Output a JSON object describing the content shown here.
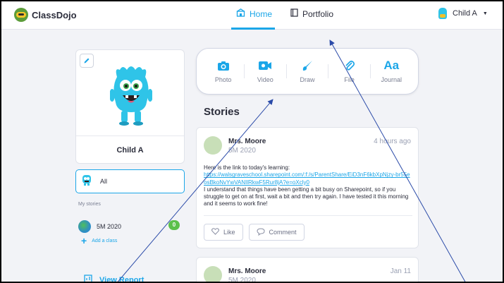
{
  "header": {
    "brand": "ClassDojo",
    "nav_home": "Home",
    "nav_portfolio": "Portfolio",
    "child_menu": "Child A",
    "accent": "#1ba6e8"
  },
  "profile": {
    "name": "Child A"
  },
  "sidebar": {
    "all_label": "All",
    "my_stories_label": "My stories",
    "class_name": "5M 2020",
    "class_badge": "0",
    "add_class_label": "Add a class",
    "view_report_label": "View Report"
  },
  "composer": {
    "items": [
      {
        "label": "Photo",
        "icon": "camera-icon"
      },
      {
        "label": "Video",
        "icon": "video-camera-icon"
      },
      {
        "label": "Draw",
        "icon": "brush-icon"
      },
      {
        "label": "File",
        "icon": "paperclip-icon"
      },
      {
        "label": "Journal",
        "icon": "text-aa-icon",
        "glyph": "Aa"
      }
    ]
  },
  "stories": {
    "title": "Stories",
    "posts": [
      {
        "author": "Mrs. Moore",
        "class": "5M 2020",
        "time": "4 hours ago",
        "intro": "Here is the link to today's learning:",
        "link": "https://walsgraveschool.sharepoint.com/:f:/s/ParentShare/EiD3nF6kbXpNjzy-br55eosBkoNvYwVANIlRkwF5Rur8jA?e=oXcly0",
        "body": "I understand that things have been getting a bit busy on Sharepoint, so if you struggle to get on at first, wait a bit and then try again. I have tested it this morning and it seems to work fine!",
        "like_label": "Like",
        "comment_label": "Comment"
      },
      {
        "author": "Mrs. Moore",
        "class": "5M 2020",
        "time": "Jan 11"
      }
    ]
  }
}
